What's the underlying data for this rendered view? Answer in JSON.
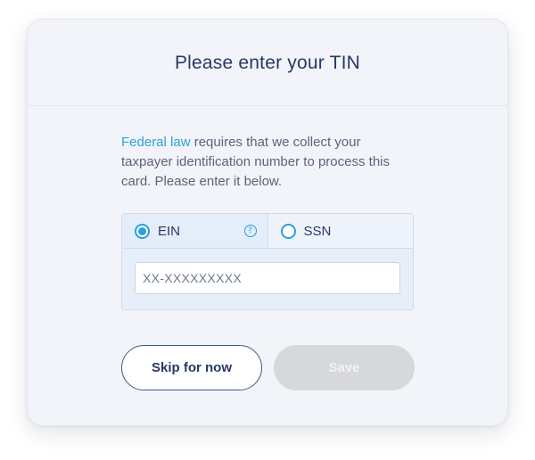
{
  "dialog": {
    "title": "Please enter your TIN",
    "description": {
      "link_text": "Federal law",
      "text": " requires that we collect your taxpayer identification number to process this card. Please enter it below."
    },
    "tin_type": {
      "options": [
        {
          "label": "EIN",
          "selected": true,
          "help_icon": "question-circle-icon"
        },
        {
          "label": "SSN",
          "selected": false
        }
      ]
    },
    "tin_input": {
      "value": "",
      "placeholder": "XX-XXXXXXXXX"
    },
    "buttons": {
      "skip_label": "Skip for now",
      "save_label": "Save",
      "save_enabled": false
    },
    "colors": {
      "accent": "#2b9fdf",
      "title": "#263a64",
      "card_bg": "#f2f4f9",
      "disabled_button": "#d6d8dc"
    }
  }
}
